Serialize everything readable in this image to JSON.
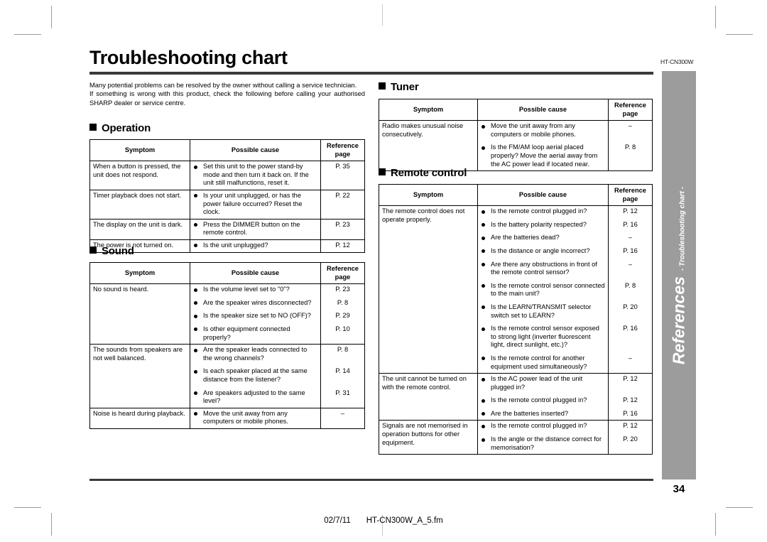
{
  "document": {
    "title": "Troubleshooting chart",
    "model_code": "HT-CN300W",
    "page_number": "34",
    "footer_date": "02/7/11",
    "footer_filename": "HT-CN300W_A_5.fm"
  },
  "intro": {
    "paragraph1": "Many potential problems can be resolved by the owner without calling a service technician.",
    "paragraph2": "If something is wrong with this product, check the following before calling your authorised SHARP dealer or service centre."
  },
  "side_tab": {
    "main": "References",
    "sub": "- Troubleshooting chart -",
    "color": "#9c9c9c"
  },
  "table_headers": {
    "symptom": "Symptom",
    "possible_cause": "Possible cause",
    "reference_page": "Reference page",
    "reference_line1": "Reference",
    "reference_line2": "page"
  },
  "sections": [
    {
      "id": "operation",
      "heading": "Operation",
      "rows": [
        {
          "symptom": "When a button is pressed, the unit does not respond.",
          "causes": [
            "Set this unit to the power stand-by mode and then turn it back on. If the unit still malfunctions, reset it."
          ],
          "refs": [
            "P. 35"
          ]
        },
        {
          "symptom": "Timer playback does not start.",
          "causes": [
            "Is your unit unplugged, or has the power failure occurred? Reset the clock."
          ],
          "refs": [
            "P. 22"
          ]
        },
        {
          "symptom": "The display on the unit is dark.",
          "causes": [
            "Press the DIMMER button on the remote control."
          ],
          "refs": [
            "P. 23"
          ]
        },
        {
          "symptom": "The power is not turned on.",
          "causes": [
            "Is the unit unplugged?"
          ],
          "refs": [
            "P. 12"
          ]
        }
      ]
    },
    {
      "id": "sound",
      "heading": "Sound",
      "rows": [
        {
          "symptom": "No sound is heard.",
          "causes": [
            "Is the volume level set to \"0\"?",
            "Are the speaker wires disconnected?",
            "Is the speaker size set to NO (OFF)?",
            "Is other equipment connected properly?"
          ],
          "refs": [
            "P. 23",
            "P. 8",
            "P. 29",
            "P. 10"
          ]
        },
        {
          "symptom": "The sounds from speakers are not well balanced.",
          "causes": [
            "Are the speaker leads connected to the wrong channels?",
            "Is each speaker placed at the same distance from the listener?",
            "Are speakers adjusted to the same level?"
          ],
          "refs": [
            "P. 8",
            "P. 14",
            "P. 31"
          ]
        },
        {
          "symptom": "Noise is heard during playback.",
          "causes": [
            "Move the unit away from any computers or mobile phones."
          ],
          "refs": [
            "–"
          ]
        }
      ]
    },
    {
      "id": "tuner",
      "heading": "Tuner",
      "rows": [
        {
          "symptom": "Radio makes unusual noise consecutively.",
          "causes": [
            "Move the unit away from any computers or mobile phones.",
            "Is the FM/AM loop aerial placed properly? Move the aerial away from the AC power lead if located near."
          ],
          "refs": [
            "–",
            "P. 8"
          ]
        }
      ]
    },
    {
      "id": "remote-control",
      "heading": "Remote control",
      "rows": [
        {
          "symptom": "The remote control does not operate properly.",
          "causes": [
            "Is the remote control plugged in?",
            "Is the battery polarity respected?",
            "Are the batteries dead?",
            "Is the distance or angle incorrect?",
            "Are there any obstructions in front of the remote control sensor?",
            "Is the remote control sensor connected to the main unit?",
            "Is the LEARN/TRANSMIT selector switch set to LEARN?",
            "Is the remote control sensor exposed to strong light (inverter fluorescent light, direct sunlight, etc.)?",
            "Is the remote control for another equipment used simultaneously?"
          ],
          "refs": [
            "P. 12",
            "P. 16",
            "–",
            "P. 16",
            "–",
            "P. 8",
            "P. 20",
            "P. 16",
            "–"
          ]
        },
        {
          "symptom": "The unit cannot be turned on with the remote control.",
          "causes": [
            "Is the AC power lead of the unit plugged in?",
            "Is the remote control plugged in?",
            "Are the batteries inserted?"
          ],
          "refs": [
            "P. 12",
            "P. 12",
            "P. 16"
          ]
        },
        {
          "symptom": "Signals are not memorised in operation buttons for other equipment.",
          "causes": [
            "Is the remote control plugged in?",
            "Is the angle or the distance correct for memorisation?"
          ],
          "refs": [
            "P. 12",
            "P. 20"
          ]
        }
      ]
    }
  ]
}
